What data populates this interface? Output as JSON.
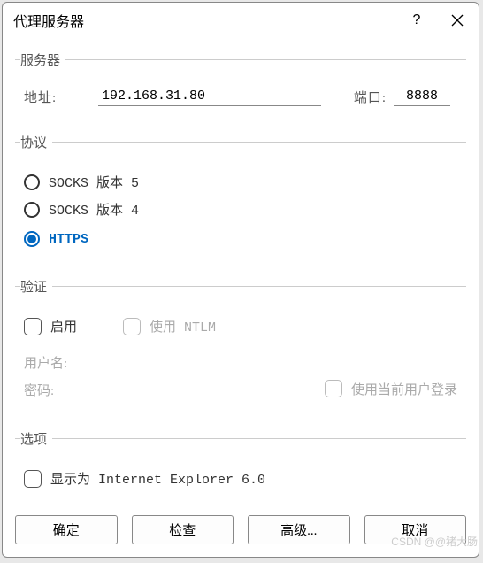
{
  "dialog": {
    "title": "代理服务器"
  },
  "server": {
    "legend": "服务器",
    "address_label": "地址:",
    "address_value": "192.168.31.80",
    "port_label": "端口:",
    "port_value": "8888"
  },
  "protocol": {
    "legend": "协议",
    "options": {
      "socks5": "SOCKS 版本 5",
      "socks4": "SOCKS 版本 4",
      "https": "HTTPS"
    }
  },
  "auth": {
    "legend": "验证",
    "enable": "启用",
    "ntlm": "使用 NTLM",
    "username_label": "用户名:",
    "password_label": "密码:",
    "use_current_user": "使用当前用户登录"
  },
  "options": {
    "legend": "选项",
    "show_as_ie6": "显示为 Internet Explorer 6.0"
  },
  "buttons": {
    "ok": "确定",
    "check": "检查",
    "advanced": "高级...",
    "cancel": "取消"
  },
  "watermark": "CSDN @@猪大肠"
}
